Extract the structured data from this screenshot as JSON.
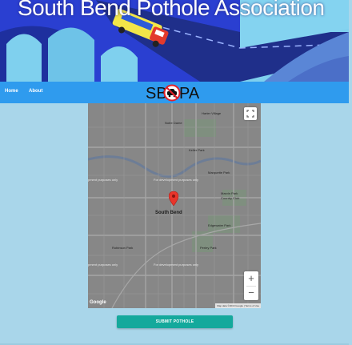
{
  "hero": {
    "title": "South Bend Pothole Association",
    "colors": {
      "sky": "#7fd0ee",
      "bridge": "#2a3fd1",
      "road": "#1f2f8a"
    }
  },
  "nav": {
    "items": [
      {
        "label": "Home"
      },
      {
        "label": "About"
      }
    ],
    "background": "#2f9bee"
  },
  "logo": {
    "left": "SB",
    "right": "PA",
    "icon": "no-car-icon"
  },
  "map": {
    "city_label": "South Bend",
    "place_labels": [
      "Harter Village",
      "Notre Dame",
      "Keller Park",
      "Marquette Park",
      "Marvin Park",
      "Country Club",
      "Edgewater Park",
      "Robinson Park",
      "Perley Park"
    ],
    "dev_watermark": "For development purposes only",
    "dev_prefix": "pment purposes only",
    "google": "Google",
    "attribution": "Map data ©2019 Google | Terms of Use",
    "zoom_in": "+",
    "zoom_out": "−",
    "icons": [
      "fullscreen-icon",
      "map-pin-icon"
    ]
  },
  "submit": {
    "label": "SUBMIT POTHOLE",
    "color": "#14a99c"
  }
}
